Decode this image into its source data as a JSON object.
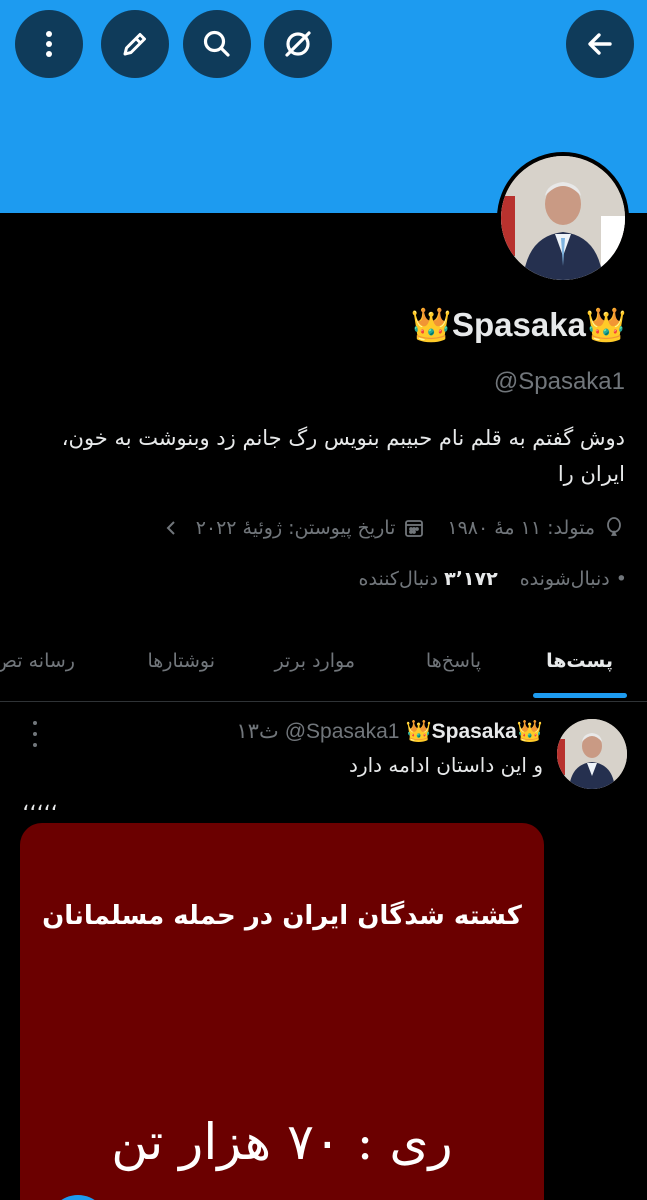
{
  "header": {
    "banner_color": "#1d9bf0",
    "buttons": [
      "more-icon",
      "edit-icon",
      "search-icon",
      "hide-icon",
      "back-arrow-icon"
    ]
  },
  "profile": {
    "name": "👑Spasaka👑",
    "handle": "@Spasaka1",
    "bio": "دوش گفتم به قلم نام حبیبم بنویس رگ جانم زد وبنوشت به خون، ایران را",
    "born": "متولد: ۱۱ مهٔ ۱۹۸۰",
    "joined": "تاریخ پیوستن: ژوئیهٔ ۲۰۲۲",
    "following_label": "دنبال‌شونده",
    "followers_count": "۳٬۱۷۲",
    "followers_label": "دنبال‌کننده"
  },
  "tabs": {
    "posts": "پست‌ها",
    "replies": "پاسخ‌ها",
    "highlights": "موارد برتر",
    "articles": "نوشتارها",
    "media": "رسانه تص"
  },
  "post": {
    "name": "👑Spasaka👑",
    "handle": "@Spasaka1",
    "time": "۱۳ث",
    "text": "و این داستان ادامه دارد",
    "quote": "،،،،،",
    "media_title": "کشته شدگان ایران در حمله مسلمانان",
    "media_big": "ری : ۷۰ هزار تن",
    "media_color": "#6b0000"
  }
}
